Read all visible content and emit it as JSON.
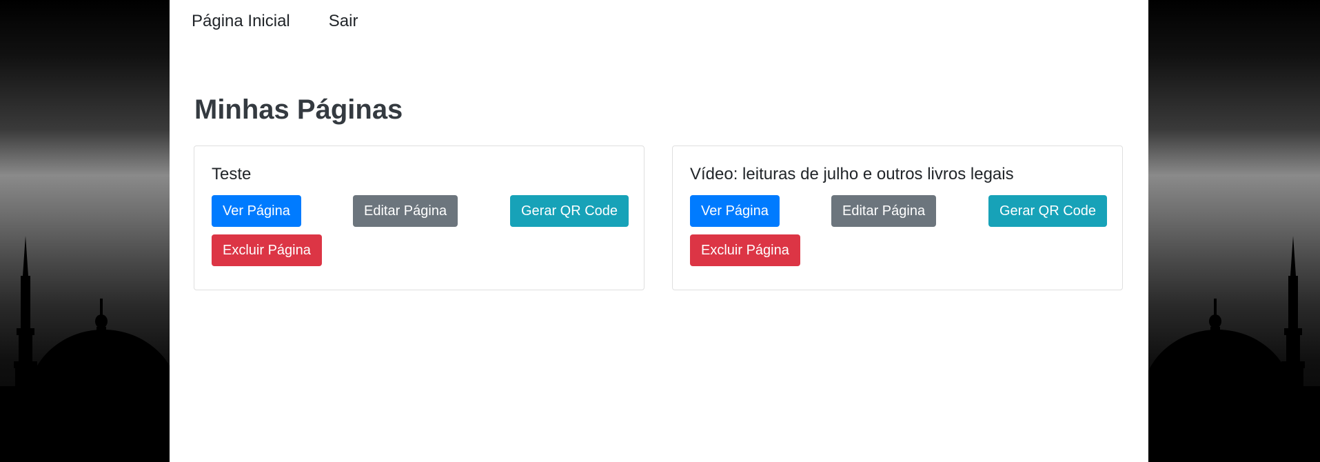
{
  "nav": {
    "home": "Página Inicial",
    "logout": "Sair"
  },
  "page": {
    "title": "Minhas Páginas"
  },
  "cards": [
    {
      "title": "Teste",
      "view_label": "Ver Página",
      "edit_label": "Editar Página",
      "qr_label": "Gerar QR Code",
      "delete_label": "Excluir Página"
    },
    {
      "title": "Vídeo: leituras de julho e outros livros legais",
      "view_label": "Ver Página",
      "edit_label": "Editar Página",
      "qr_label": "Gerar QR Code",
      "delete_label": "Excluir Página"
    }
  ],
  "colors": {
    "primary": "#007bff",
    "secondary": "#6c757d",
    "info": "#17a2b8",
    "danger": "#dc3545",
    "background": "#000000",
    "surface": "#ffffff"
  },
  "background_image": "mosque-silhouette"
}
